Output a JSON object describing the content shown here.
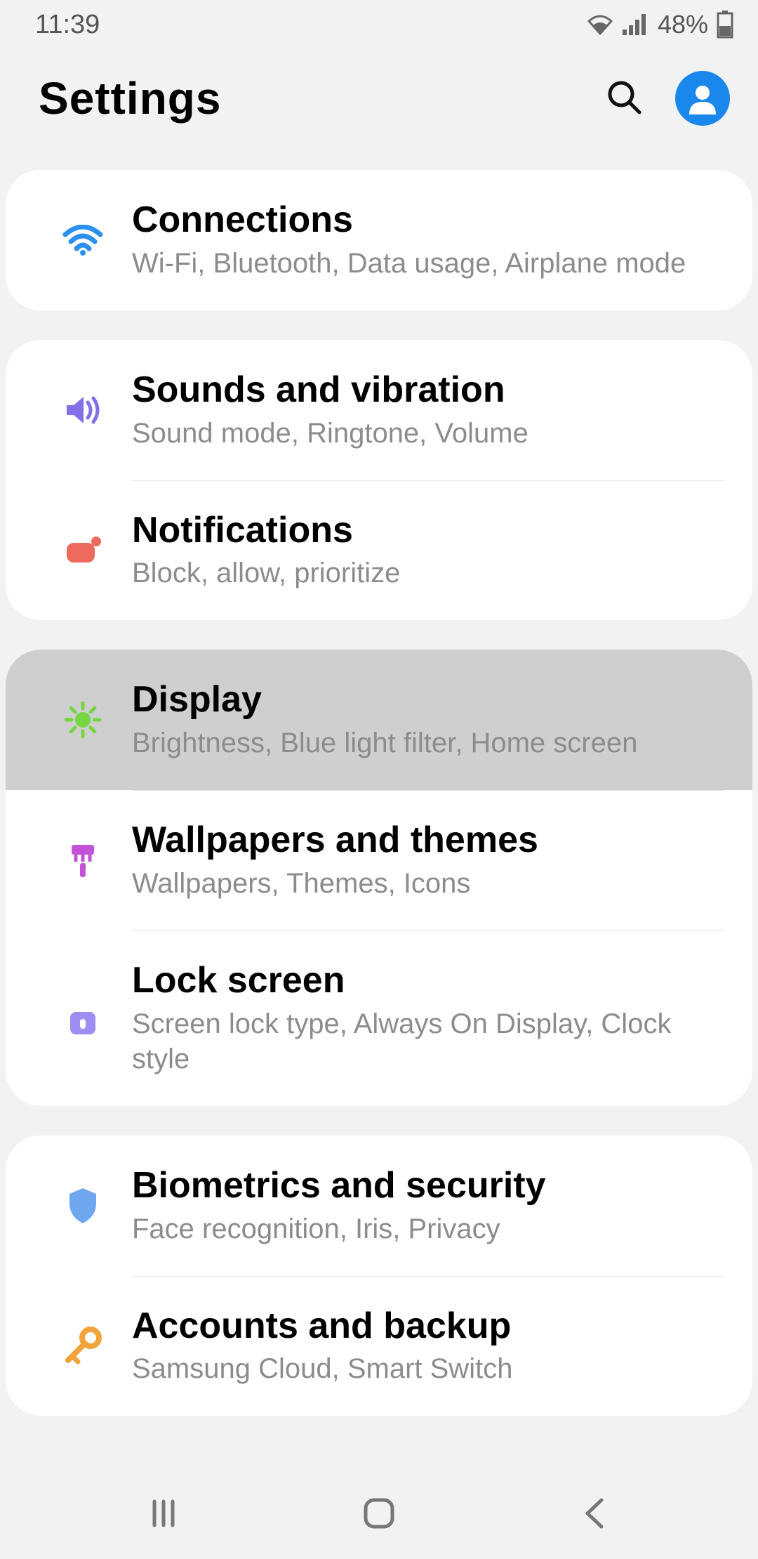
{
  "status": {
    "time": "11:39",
    "battery_text": "48%"
  },
  "header": {
    "title": "Settings"
  },
  "colors": {
    "wifi": "#2d8ff0",
    "sound": "#836fe8",
    "notif": "#ec6b5c",
    "display": "#75d642",
    "themes": "#c452d9",
    "lock": "#9e8ef2",
    "security": "#6fa7ee",
    "accounts": "#f0a43b",
    "avatar": "#1a87ec"
  },
  "groups": [
    {
      "items": [
        {
          "id": "connections",
          "title": "Connections",
          "sub": "Wi-Fi, Bluetooth, Data usage, Airplane mode",
          "icon": "wifi-icon",
          "pressed": false
        }
      ]
    },
    {
      "items": [
        {
          "id": "sounds",
          "title": "Sounds and vibration",
          "sub": "Sound mode, Ringtone, Volume",
          "icon": "sound-icon",
          "pressed": false
        },
        {
          "id": "notifications",
          "title": "Notifications",
          "sub": "Block, allow, prioritize",
          "icon": "notification-icon",
          "pressed": false
        }
      ]
    },
    {
      "items": [
        {
          "id": "display",
          "title": "Display",
          "sub": "Brightness, Blue light filter, Home screen",
          "icon": "brightness-icon",
          "pressed": true
        },
        {
          "id": "wallpapers",
          "title": "Wallpapers and themes",
          "sub": "Wallpapers, Themes, Icons",
          "icon": "paint-icon",
          "pressed": false
        },
        {
          "id": "lockscreen",
          "title": "Lock screen",
          "sub": "Screen lock type, Always On Display, Clock style",
          "icon": "lock-icon",
          "pressed": false
        }
      ]
    },
    {
      "items": [
        {
          "id": "biometrics",
          "title": "Biometrics and security",
          "sub": "Face recognition, Iris, Privacy",
          "icon": "shield-icon",
          "pressed": false
        },
        {
          "id": "accounts",
          "title": "Accounts and backup",
          "sub": "Samsung Cloud, Smart Switch",
          "icon": "key-icon",
          "pressed": false
        }
      ]
    }
  ]
}
